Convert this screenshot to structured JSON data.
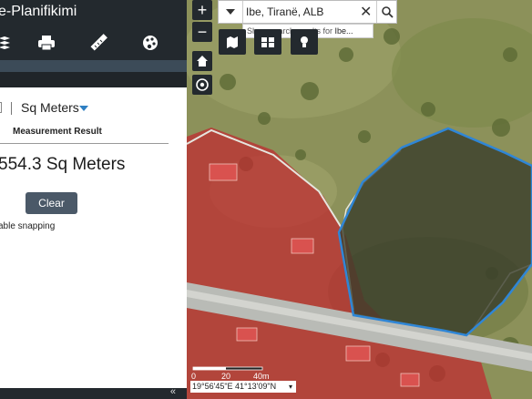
{
  "app": {
    "title": "e-Planifikimi"
  },
  "toolbar": {
    "tools": [
      {
        "icon": "layers-icon"
      },
      {
        "icon": "print-icon"
      },
      {
        "icon": "ruler-icon"
      },
      {
        "icon": "palette-icon"
      }
    ]
  },
  "measure": {
    "units_label": "Sq Meters",
    "result_label": "Measurement Result",
    "result_value": "554.3 Sq Meters",
    "clear_label": "Clear",
    "snapping_label": "able snapping"
  },
  "map": {
    "zoom_in": "+",
    "zoom_out": "−",
    "search_value": "Ibe, Tiranë, ALB",
    "search_clear": "✕",
    "suggestion_prefix": "Show search results for ",
    "suggestion_term": "Ibe...",
    "scale_labels": [
      "0",
      "20",
      "40m"
    ],
    "coordinates": "19°56'45\"E 41°13'09\"N"
  },
  "colors": {
    "panel_dark": "#23292e",
    "accent": "#2e7fc2",
    "button": "#4b5968",
    "zone_red": "#c0282f",
    "measure_outline": "#2f86d6"
  }
}
